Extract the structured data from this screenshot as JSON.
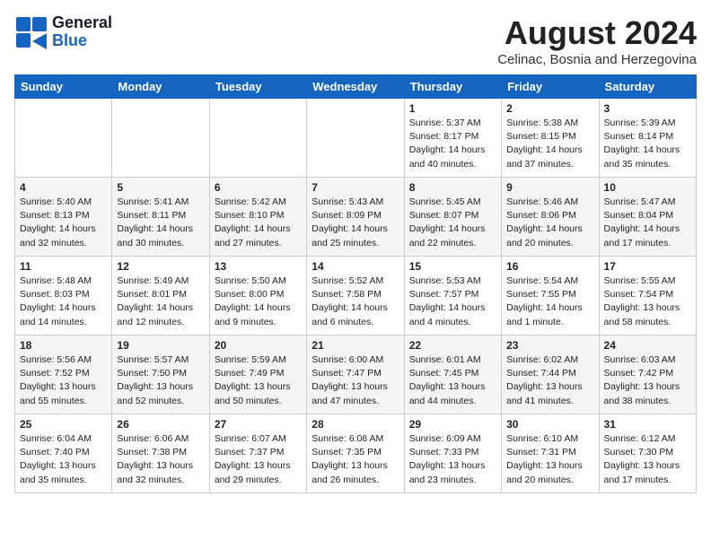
{
  "logo": {
    "general": "General",
    "blue": "Blue"
  },
  "title": {
    "month_year": "August 2024",
    "location": "Celinac, Bosnia and Herzegovina"
  },
  "headers": [
    "Sunday",
    "Monday",
    "Tuesday",
    "Wednesday",
    "Thursday",
    "Friday",
    "Saturday"
  ],
  "weeks": [
    [
      {
        "day": "",
        "info": ""
      },
      {
        "day": "",
        "info": ""
      },
      {
        "day": "",
        "info": ""
      },
      {
        "day": "",
        "info": ""
      },
      {
        "day": "1",
        "info": "Sunrise: 5:37 AM\nSunset: 8:17 PM\nDaylight: 14 hours\nand 40 minutes."
      },
      {
        "day": "2",
        "info": "Sunrise: 5:38 AM\nSunset: 8:15 PM\nDaylight: 14 hours\nand 37 minutes."
      },
      {
        "day": "3",
        "info": "Sunrise: 5:39 AM\nSunset: 8:14 PM\nDaylight: 14 hours\nand 35 minutes."
      }
    ],
    [
      {
        "day": "4",
        "info": "Sunrise: 5:40 AM\nSunset: 8:13 PM\nDaylight: 14 hours\nand 32 minutes."
      },
      {
        "day": "5",
        "info": "Sunrise: 5:41 AM\nSunset: 8:11 PM\nDaylight: 14 hours\nand 30 minutes."
      },
      {
        "day": "6",
        "info": "Sunrise: 5:42 AM\nSunset: 8:10 PM\nDaylight: 14 hours\nand 27 minutes."
      },
      {
        "day": "7",
        "info": "Sunrise: 5:43 AM\nSunset: 8:09 PM\nDaylight: 14 hours\nand 25 minutes."
      },
      {
        "day": "8",
        "info": "Sunrise: 5:45 AM\nSunset: 8:07 PM\nDaylight: 14 hours\nand 22 minutes."
      },
      {
        "day": "9",
        "info": "Sunrise: 5:46 AM\nSunset: 8:06 PM\nDaylight: 14 hours\nand 20 minutes."
      },
      {
        "day": "10",
        "info": "Sunrise: 5:47 AM\nSunset: 8:04 PM\nDaylight: 14 hours\nand 17 minutes."
      }
    ],
    [
      {
        "day": "11",
        "info": "Sunrise: 5:48 AM\nSunset: 8:03 PM\nDaylight: 14 hours\nand 14 minutes."
      },
      {
        "day": "12",
        "info": "Sunrise: 5:49 AM\nSunset: 8:01 PM\nDaylight: 14 hours\nand 12 minutes."
      },
      {
        "day": "13",
        "info": "Sunrise: 5:50 AM\nSunset: 8:00 PM\nDaylight: 14 hours\nand 9 minutes."
      },
      {
        "day": "14",
        "info": "Sunrise: 5:52 AM\nSunset: 7:58 PM\nDaylight: 14 hours\nand 6 minutes."
      },
      {
        "day": "15",
        "info": "Sunrise: 5:53 AM\nSunset: 7:57 PM\nDaylight: 14 hours\nand 4 minutes."
      },
      {
        "day": "16",
        "info": "Sunrise: 5:54 AM\nSunset: 7:55 PM\nDaylight: 14 hours\nand 1 minute."
      },
      {
        "day": "17",
        "info": "Sunrise: 5:55 AM\nSunset: 7:54 PM\nDaylight: 13 hours\nand 58 minutes."
      }
    ],
    [
      {
        "day": "18",
        "info": "Sunrise: 5:56 AM\nSunset: 7:52 PM\nDaylight: 13 hours\nand 55 minutes."
      },
      {
        "day": "19",
        "info": "Sunrise: 5:57 AM\nSunset: 7:50 PM\nDaylight: 13 hours\nand 52 minutes."
      },
      {
        "day": "20",
        "info": "Sunrise: 5:59 AM\nSunset: 7:49 PM\nDaylight: 13 hours\nand 50 minutes."
      },
      {
        "day": "21",
        "info": "Sunrise: 6:00 AM\nSunset: 7:47 PM\nDaylight: 13 hours\nand 47 minutes."
      },
      {
        "day": "22",
        "info": "Sunrise: 6:01 AM\nSunset: 7:45 PM\nDaylight: 13 hours\nand 44 minutes."
      },
      {
        "day": "23",
        "info": "Sunrise: 6:02 AM\nSunset: 7:44 PM\nDaylight: 13 hours\nand 41 minutes."
      },
      {
        "day": "24",
        "info": "Sunrise: 6:03 AM\nSunset: 7:42 PM\nDaylight: 13 hours\nand 38 minutes."
      }
    ],
    [
      {
        "day": "25",
        "info": "Sunrise: 6:04 AM\nSunset: 7:40 PM\nDaylight: 13 hours\nand 35 minutes."
      },
      {
        "day": "26",
        "info": "Sunrise: 6:06 AM\nSunset: 7:38 PM\nDaylight: 13 hours\nand 32 minutes."
      },
      {
        "day": "27",
        "info": "Sunrise: 6:07 AM\nSunset: 7:37 PM\nDaylight: 13 hours\nand 29 minutes."
      },
      {
        "day": "28",
        "info": "Sunrise: 6:08 AM\nSunset: 7:35 PM\nDaylight: 13 hours\nand 26 minutes."
      },
      {
        "day": "29",
        "info": "Sunrise: 6:09 AM\nSunset: 7:33 PM\nDaylight: 13 hours\nand 23 minutes."
      },
      {
        "day": "30",
        "info": "Sunrise: 6:10 AM\nSunset: 7:31 PM\nDaylight: 13 hours\nand 20 minutes."
      },
      {
        "day": "31",
        "info": "Sunrise: 6:12 AM\nSunset: 7:30 PM\nDaylight: 13 hours\nand 17 minutes."
      }
    ]
  ]
}
